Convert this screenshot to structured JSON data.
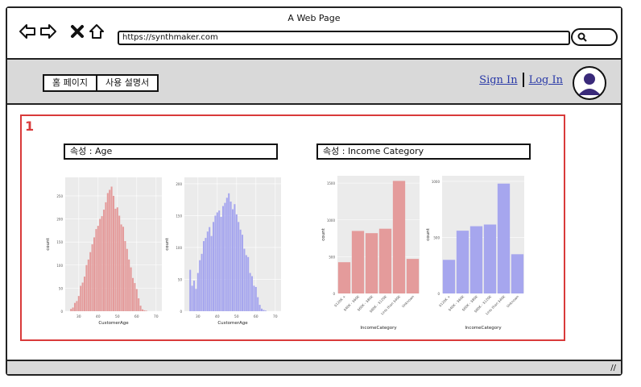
{
  "window": {
    "title": "A Web Page",
    "url": "https://synthmaker.com"
  },
  "nav": {
    "tabs": [
      "홈 페이지",
      "사용 설명서"
    ],
    "sign_in": "Sign In",
    "log_in": "Log In"
  },
  "content": {
    "marker": "1",
    "sections": [
      {
        "title": "속성 : Age"
      },
      {
        "title": "속성 : Income Category"
      }
    ]
  },
  "icons": {
    "back": "arrow-left-icon",
    "forward": "arrow-right-icon",
    "close": "close-icon",
    "home": "home-icon",
    "search": "search-icon",
    "avatar": "user-icon",
    "resize": "resize-grip-icon"
  },
  "colors": {
    "red": "#e49b9b",
    "blue": "#a6a6ee",
    "panel": "#ebebeb",
    "marker": "#d93a3a"
  },
  "chart_data": [
    {
      "type": "bar",
      "title": "",
      "xlabel": "CustomerAge",
      "ylabel": "count",
      "x": [
        26,
        27,
        28,
        29,
        30,
        31,
        32,
        33,
        34,
        35,
        36,
        37,
        38,
        39,
        40,
        41,
        42,
        43,
        44,
        45,
        46,
        47,
        48,
        49,
        50,
        51,
        52,
        53,
        54,
        55,
        56,
        57,
        58,
        59,
        60,
        61,
        62,
        63,
        64,
        65
      ],
      "values": [
        5,
        8,
        18,
        22,
        33,
        55,
        62,
        75,
        100,
        112,
        128,
        145,
        160,
        178,
        185,
        200,
        206,
        220,
        236,
        256,
        263,
        270,
        250,
        222,
        225,
        207,
        188,
        183,
        152,
        135,
        112,
        95,
        72,
        61,
        48,
        28,
        12,
        4,
        2,
        1
      ],
      "xlim": [
        23,
        73
      ],
      "ylim": [
        0,
        290
      ],
      "xticks": [
        30,
        40,
        50,
        60,
        70
      ],
      "yticks": [
        0,
        50,
        100,
        150,
        200,
        250
      ],
      "color": "#e49b9b"
    },
    {
      "type": "bar",
      "title": "",
      "xlabel": "CustomerAge",
      "ylabel": "count",
      "x": [
        26,
        27,
        28,
        29,
        30,
        31,
        32,
        33,
        34,
        35,
        36,
        37,
        38,
        39,
        40,
        41,
        42,
        43,
        44,
        45,
        46,
        47,
        48,
        49,
        50,
        51,
        52,
        53,
        54,
        55,
        56,
        57,
        58,
        59,
        60,
        61,
        62,
        63,
        64,
        65
      ],
      "values": [
        65,
        40,
        48,
        35,
        60,
        80,
        90,
        110,
        115,
        125,
        132,
        118,
        140,
        150,
        155,
        158,
        148,
        165,
        170,
        178,
        185,
        172,
        160,
        168,
        152,
        140,
        128,
        120,
        98,
        88,
        85,
        60,
        55,
        40,
        38,
        22,
        10,
        4,
        2,
        1
      ],
      "xlim": [
        23,
        73
      ],
      "ylim": [
        0,
        210
      ],
      "xticks": [
        30,
        40,
        50,
        60,
        70
      ],
      "yticks": [
        0,
        50,
        100,
        150,
        200
      ],
      "color": "#a6a6ee"
    },
    {
      "type": "bar",
      "title": "",
      "xlabel": "IncomeCategory",
      "ylabel": "count",
      "categories": [
        "$120K +",
        "$40K - $60K",
        "$60K - $80K",
        "$80K - $120K",
        "Less than $40K",
        "Unknown"
      ],
      "values": [
        425,
        850,
        820,
        880,
        1530,
        470
      ],
      "ylim": [
        0,
        1600
      ],
      "yticks": [
        0,
        500,
        1000,
        1500
      ],
      "color": "#e49b9b"
    },
    {
      "type": "bar",
      "title": "",
      "xlabel": "IncomeCategory",
      "ylabel": "count",
      "categories": [
        "$120K +",
        "$40K - $60K",
        "$60K - $80K",
        "$80K - $120K",
        "Less than $40K",
        "Unknown"
      ],
      "values": [
        300,
        560,
        600,
        615,
        980,
        350
      ],
      "ylim": [
        0,
        1050
      ],
      "yticks": [
        0,
        500,
        1000
      ],
      "color": "#a6a6ee"
    }
  ]
}
